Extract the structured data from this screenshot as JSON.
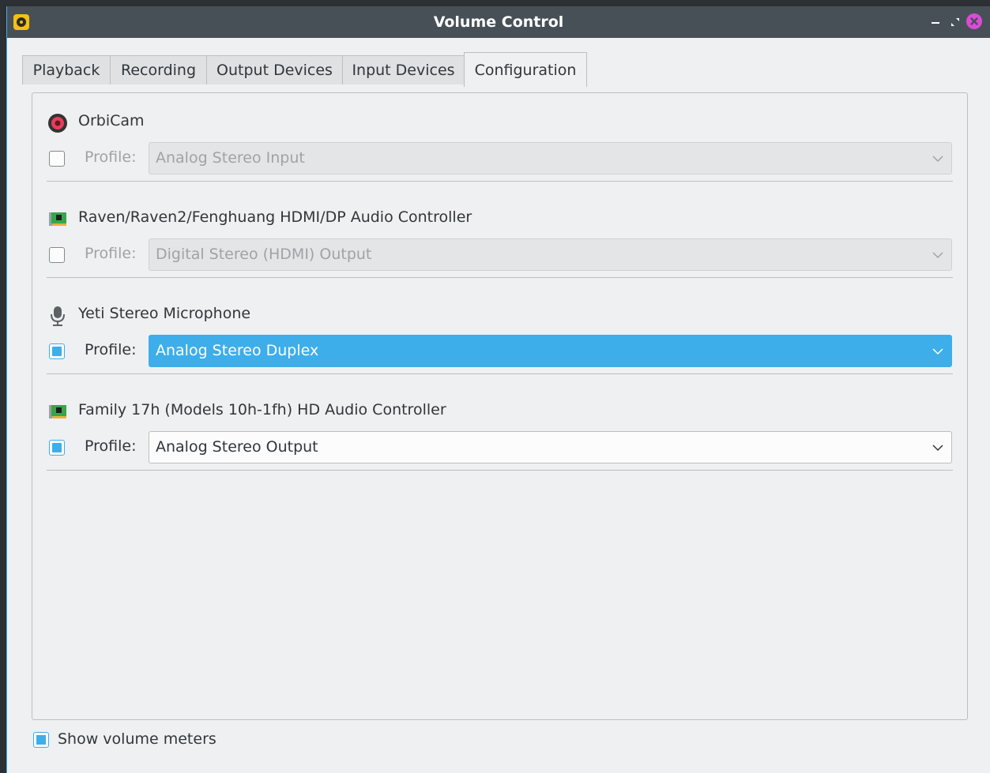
{
  "window": {
    "title": "Volume Control"
  },
  "tabs": [
    {
      "label": "Playback"
    },
    {
      "label": "Recording"
    },
    {
      "label": "Output Devices"
    },
    {
      "label": "Input Devices"
    },
    {
      "label": "Configuration",
      "active": true
    }
  ],
  "devices": [
    {
      "name": "OrbiCam",
      "icon": "webcam-icon",
      "enabled": false,
      "profile_label": "Profile:",
      "profile": "Analog Stereo Input"
    },
    {
      "name": "Raven/Raven2/Fenghuang HDMI/DP Audio Controller",
      "icon": "sound-card-icon",
      "enabled": false,
      "profile_label": "Profile:",
      "profile": "Digital Stereo (HDMI) Output"
    },
    {
      "name": "Yeti Stereo Microphone",
      "icon": "microphone-icon",
      "enabled": true,
      "profile_label": "Profile:",
      "profile": "Analog Stereo Duplex"
    },
    {
      "name": "Family 17h (Models 10h-1fh) HD Audio Controller",
      "icon": "sound-card-icon",
      "enabled": true,
      "profile_label": "Profile:",
      "profile": "Analog Stereo Output"
    }
  ],
  "footer": {
    "show_meters_label": "Show volume meters",
    "show_meters_checked": true
  },
  "colors": {
    "accent": "#3daee9",
    "titlebar": "#475057",
    "close": "#da4bd6"
  }
}
